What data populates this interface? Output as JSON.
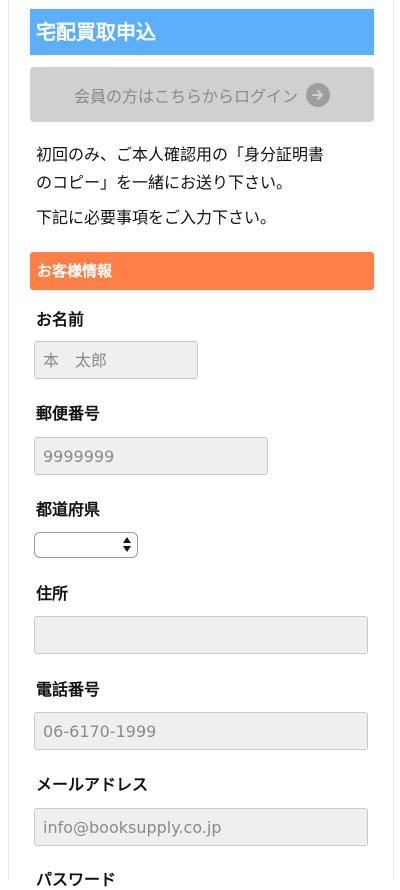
{
  "page": {
    "title": "宅配買取申込",
    "login_button": "会員の方はこちらからログイン",
    "intro_line1": "初回のみ、ご本人確認用の「身分証明書",
    "intro_line2": "のコピー」を一緒にお送り下さい。",
    "intro_line3": "下記に必要事項をご入力下さい。"
  },
  "section": {
    "title": "お客様情報"
  },
  "form": {
    "name_label": "お名前",
    "name_placeholder": "本　太郎",
    "zip_label": "郵便番号",
    "zip_placeholder": "9999999",
    "pref_label": "都道府県",
    "pref_value": "",
    "address_label": "住所",
    "address_placeholder": "",
    "phone_label": "電話番号",
    "phone_placeholder": "06-6170-1999",
    "email_label": "メールアドレス",
    "email_placeholder": "info@booksupply.co.jp",
    "password_label": "パスワード"
  },
  "colors": {
    "title_bg": "#5cb0fb",
    "section_bg": "#ff8046",
    "login_bg": "#d0d0d0"
  },
  "icons": {
    "login_arrow": "arrow-right-circle-icon",
    "select_arrows": "chevron-updown-icon"
  }
}
